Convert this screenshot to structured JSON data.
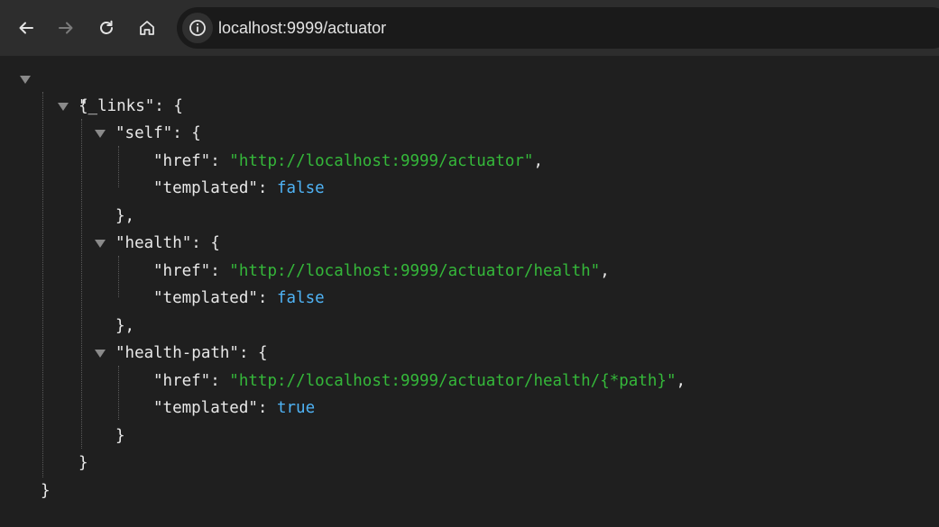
{
  "browser": {
    "url": "localhost:9999/actuator",
    "icons": {
      "back": "arrow-left-icon",
      "forward": "arrow-right-icon",
      "reload": "reload-icon",
      "home": "home-icon",
      "info": "info-icon",
      "collapse": "triangle-down-icon"
    }
  },
  "json_view": {
    "open_root": "{",
    "links_key": "\"_links\"",
    "colon_brace": ": {",
    "colon": ": ",
    "comma": ",",
    "close_obj_comma": "},",
    "close_obj": "}",
    "href_key": "\"href\"",
    "templated_key": "\"templated\"",
    "self": {
      "key": "\"self\"",
      "href": "\"http://localhost:9999/actuator\"",
      "templated": "false"
    },
    "health": {
      "key": "\"health\"",
      "href": "\"http://localhost:9999/actuator/health\"",
      "templated": "false"
    },
    "health_path": {
      "key": "\"health-path\"",
      "href": "\"http://localhost:9999/actuator/health/{*path}\"",
      "templated": "true"
    }
  },
  "colors": {
    "background": "#1f1f1f",
    "string": "#35b83a",
    "boolean": "#4fb3f5",
    "text": "#e8e8e8"
  }
}
